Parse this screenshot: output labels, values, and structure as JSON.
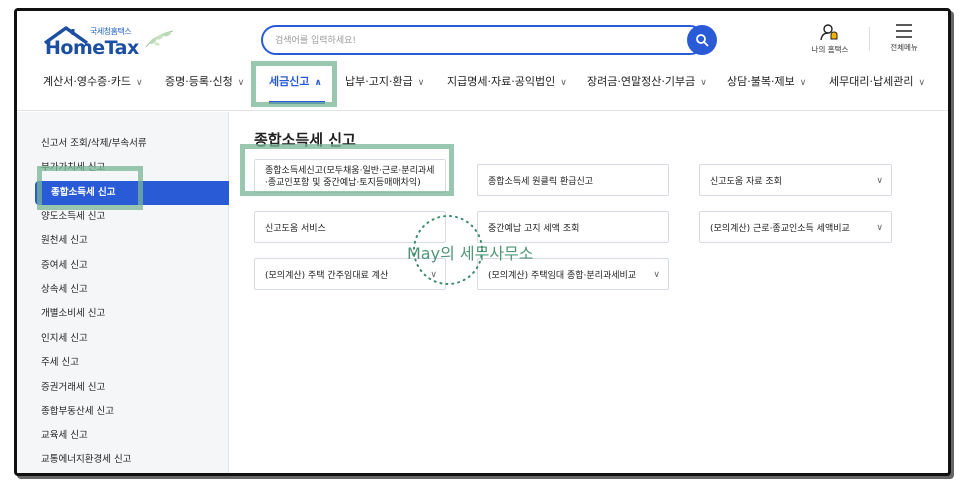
{
  "header": {
    "logo_sub": "국세청홈택스",
    "logo_text": "HomeTax",
    "search_placeholder": "검색어를 입력하세요!",
    "mine_label": "나의 홈택스",
    "all_menu_label": "전체메뉴"
  },
  "gnb": [
    {
      "label": "계산서·영수증·카드"
    },
    {
      "label": "증명·등록·신청"
    },
    {
      "label": "세금신고",
      "active": true
    },
    {
      "label": "납부·고지·환급"
    },
    {
      "label": "지급명세·자료·공익법인"
    },
    {
      "label": "장려금·연말정산·기부금"
    },
    {
      "label": "상담·불복·제보"
    },
    {
      "label": "세무대리·납세관리"
    }
  ],
  "sidebar": {
    "items": [
      {
        "label": "신고서 조회/삭제/부속서류"
      },
      {
        "label": "부가가치세 신고"
      },
      {
        "label": "종합소득세 신고",
        "active": true
      },
      {
        "label": "양도소득세 신고"
      },
      {
        "label": "원천세 신고"
      },
      {
        "label": "증여세 신고"
      },
      {
        "label": "상속세 신고"
      },
      {
        "label": "개별소비세 신고"
      },
      {
        "label": "인지세 신고"
      },
      {
        "label": "주세 신고"
      },
      {
        "label": "증권거래세 신고"
      },
      {
        "label": "종합부동산세 신고"
      },
      {
        "label": "교육세 신고"
      },
      {
        "label": "교통에너지환경세 신고"
      }
    ]
  },
  "main": {
    "title": "종합소득세 신고",
    "cards": [
      {
        "label": "종합소득세신고(모두채움·일반·근로·분리과세·종교인포함 및 중간예납·토지등매매차익)"
      },
      {
        "label": "종합소득세 원클릭 환급신고"
      },
      {
        "label": "신고도움 자료 조회"
      },
      {
        "label": "신고도움 서비스"
      },
      {
        "label": "중간예납 고지 세액 조회"
      },
      {
        "label": "(모의계산) 근로·종교인소득 세액비교"
      },
      {
        "label": "(모의계산) 주택 간주임대료 계산"
      },
      {
        "label": "(모의계산) 주택임대 종합·분리과세비교"
      }
    ]
  },
  "watermark": "May의 세무사무소",
  "colors": {
    "accent": "#2a5bd7",
    "highlight": "#78b496"
  }
}
